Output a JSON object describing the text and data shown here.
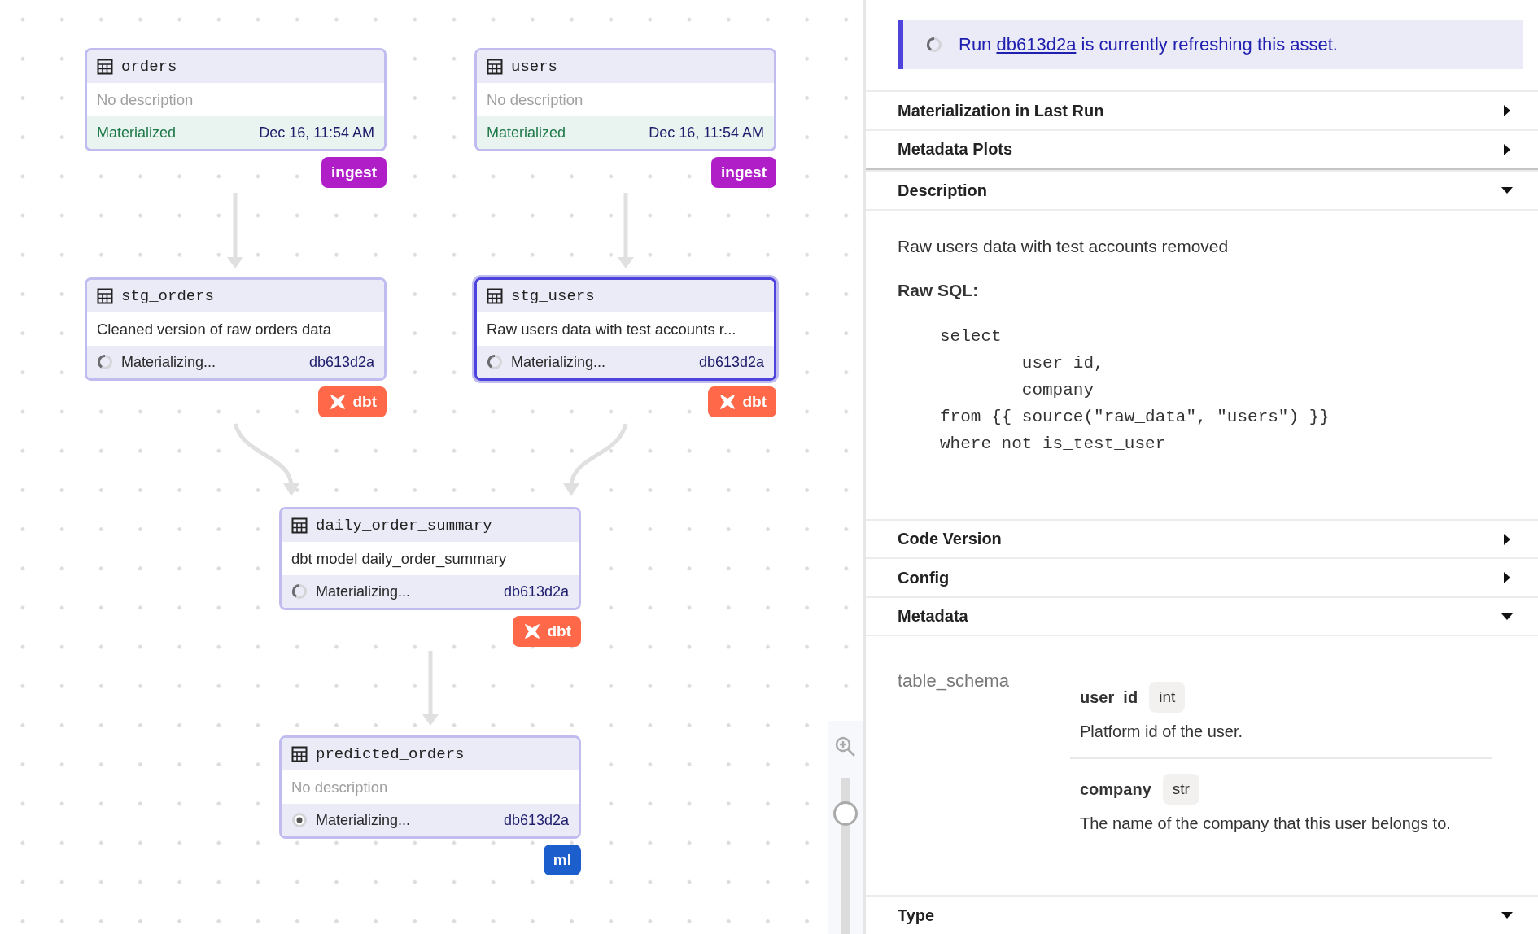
{
  "graph": {
    "nodes": [
      {
        "name": "orders",
        "description": "No description",
        "description_empty": true,
        "status": {
          "kind": "materialized",
          "label": "Materialized",
          "detail": "Dec 16, 11:54 AM"
        },
        "tag": {
          "label": "ingest",
          "kind": "plain",
          "color": "#b01ec8"
        },
        "selected": false
      },
      {
        "name": "users",
        "description": "No description",
        "description_empty": true,
        "status": {
          "kind": "materialized",
          "label": "Materialized",
          "detail": "Dec 16, 11:54 AM"
        },
        "tag": {
          "label": "ingest",
          "kind": "plain",
          "color": "#b01ec8"
        },
        "selected": false
      },
      {
        "name": "stg_orders",
        "description": "Cleaned version of raw orders data",
        "description_empty": false,
        "status": {
          "kind": "materializing",
          "label": "Materializing...",
          "detail": "db613d2a"
        },
        "tag": {
          "label": "dbt",
          "kind": "dbt",
          "color": "#ff694a"
        },
        "selected": false
      },
      {
        "name": "stg_users",
        "description": "Raw users data with test accounts r...",
        "description_empty": false,
        "status": {
          "kind": "materializing",
          "label": "Materializing...",
          "detail": "db613d2a"
        },
        "tag": {
          "label": "dbt",
          "kind": "dbt",
          "color": "#ff694a"
        },
        "selected": true
      },
      {
        "name": "daily_order_summary",
        "description": "dbt model daily_order_summary",
        "description_empty": false,
        "status": {
          "kind": "materializing",
          "label": "Materializing...",
          "detail": "db613d2a"
        },
        "tag": {
          "label": "dbt",
          "kind": "dbt",
          "color": "#ff694a"
        },
        "selected": false
      },
      {
        "name": "predicted_orders",
        "description": "No description",
        "description_empty": true,
        "status": {
          "kind": "queued",
          "label": "Materializing...",
          "detail": "db613d2a"
        },
        "tag": {
          "label": "ml",
          "kind": "plain",
          "color": "#1c5fcc"
        },
        "selected": false
      }
    ],
    "zoom": {
      "level": 0.78
    }
  },
  "panel": {
    "alert": {
      "prefix": "Run",
      "link": "db613d2a",
      "suffix": "is currently refreshing this asset."
    },
    "sections": [
      {
        "title": "Materialization in Last Run",
        "expanded": false
      },
      {
        "title": "Metadata Plots",
        "expanded": false
      },
      {
        "title": "Description",
        "expanded": true,
        "kind": "description",
        "text": "Raw users data with test accounts removed",
        "sql_label": "Raw SQL:",
        "sql": "select\n        user_id,\n        company\nfrom {{ source(\"raw_data\", \"users\") }}\nwhere not is_test_user"
      },
      {
        "title": "Code Version",
        "expanded": false
      },
      {
        "title": "Config",
        "expanded": false
      },
      {
        "title": "Metadata",
        "expanded": true,
        "kind": "metadata",
        "key": "table_schema",
        "columns": [
          {
            "name": "user_id",
            "type": "int",
            "description": "Platform id of the user."
          },
          {
            "name": "company",
            "type": "str",
            "description": "The name of the company that this user belongs to."
          }
        ]
      },
      {
        "title": "Type",
        "expanded": true
      }
    ]
  }
}
